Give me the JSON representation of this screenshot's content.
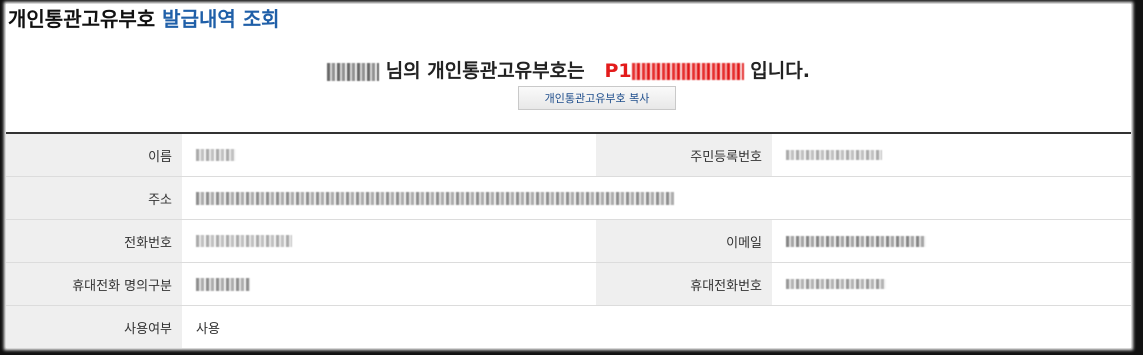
{
  "header": {
    "title_part1": "개인통관고유부호",
    "title_part2": "발급내역 조회"
  },
  "notice": {
    "honorific": "님의 개인통관고유부호는",
    "code_prefix": "P1",
    "suffix": "입니다."
  },
  "copy_button_label": "개인통관고유부호 복사",
  "fields": {
    "name_label": "이름",
    "rrn_label": "주민등록번호",
    "address_label": "주소",
    "phone_label": "전화번호",
    "email_label": "이메일",
    "mobile_owner_label": "휴대전화 명의구분",
    "mobile_label": "휴대전화번호",
    "usage_label": "사용여부",
    "usage_value": "사용"
  },
  "colors": {
    "title_accent": "#1f5fa8",
    "code_red": "#e31b1b"
  }
}
